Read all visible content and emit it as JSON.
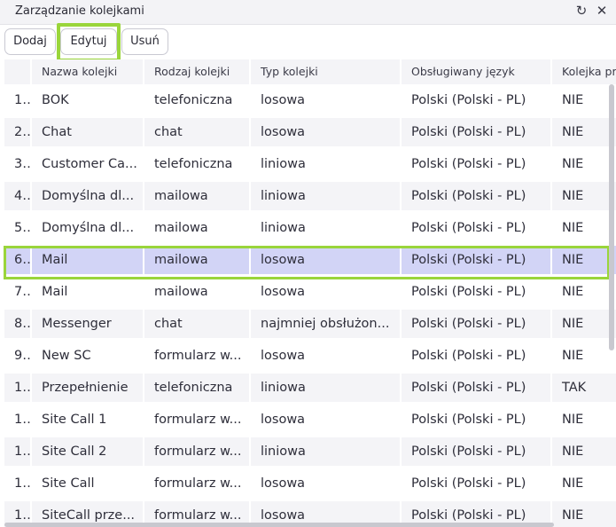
{
  "window": {
    "title": "Zarządzanie kolejkami",
    "refresh_icon": "refresh-icon",
    "close_icon": "close-icon"
  },
  "toolbar": {
    "add_label": "Dodaj",
    "edit_label": "Edytuj",
    "delete_label": "Usuń"
  },
  "table": {
    "columns": [
      "",
      "Nazwa kolejki",
      "Rodzaj kolejki",
      "Typ kolejki",
      "Obsługiwany język",
      "Kolejka pr"
    ],
    "selected_row": 5,
    "rows": [
      [
        "1...",
        "BOK",
        "telefoniczna",
        "losowa",
        "Polski (Polski - PL)",
        "NIE"
      ],
      [
        "2...",
        "Chat",
        "chat",
        "losowa",
        "Polski (Polski - PL)",
        "NIE"
      ],
      [
        "3...",
        "Customer Ca...",
        "telefoniczna",
        "liniowa",
        "Polski (Polski - PL)",
        "NIE"
      ],
      [
        "4...",
        "Domyślna dl...",
        "mailowa",
        "liniowa",
        "Polski (Polski - PL)",
        "NIE"
      ],
      [
        "5...",
        "Domyślna dl...",
        "mailowa",
        "liniowa",
        "Polski (Polski - PL)",
        "NIE"
      ],
      [
        "6...",
        "Mail",
        "mailowa",
        "losowa",
        "Polski (Polski - PL)",
        "NIE"
      ],
      [
        "7...",
        "Mail",
        "mailowa",
        "losowa",
        "Polski (Polski - PL)",
        "NIE"
      ],
      [
        "8...",
        "Messenger",
        "chat",
        "najmniej obsłużon...",
        "Polski (Polski - PL)",
        "NIE"
      ],
      [
        "9...",
        "New SC",
        "formularz w...",
        "losowa",
        "Polski (Polski - PL)",
        "NIE"
      ],
      [
        "1...",
        "Przepełnienie",
        "telefoniczna",
        "liniowa",
        "Polski (Polski - PL)",
        "TAK"
      ],
      [
        "1...",
        "Site Call 1",
        "formularz w...",
        "losowa",
        "Polski (Polski - PL)",
        "NIE"
      ],
      [
        "1...",
        "Site Call 2",
        "formularz w...",
        "liniowa",
        "Polski (Polski - PL)",
        "NIE"
      ],
      [
        "1...",
        "Site Call",
        "formularz w...",
        "losowa",
        "Polski (Polski - PL)",
        "NIE"
      ],
      [
        "1...",
        "SiteCall prze...",
        "formularz w...",
        "losowa",
        "Polski (Polski - PL)",
        "NIE"
      ]
    ]
  },
  "colors": {
    "selection": "#d2d4f6",
    "highlight": "#9ad53b",
    "stripe": "#f4f4f7"
  }
}
